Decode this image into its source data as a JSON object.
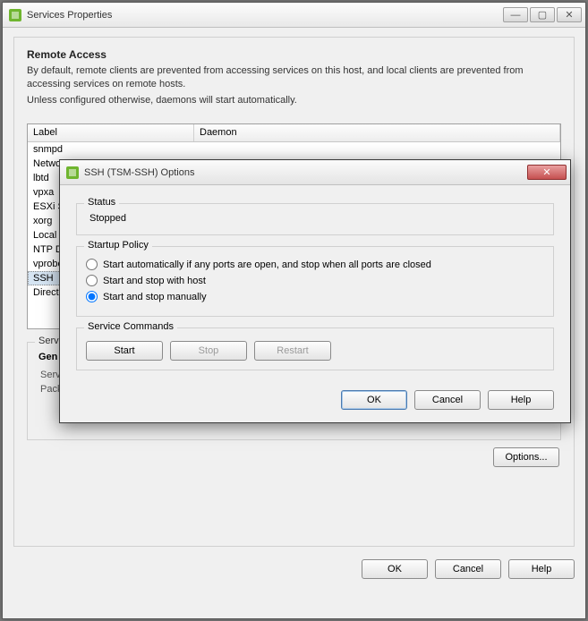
{
  "main": {
    "title": "Services Properties",
    "section_title": "Remote Access",
    "desc1": "By default, remote clients are prevented from accessing services on this host, and local clients are prevented from accessing services on remote hosts.",
    "desc2": "Unless configured otherwise, daemons will start automatically.",
    "columns": {
      "label": "Label",
      "daemon": "Daemon"
    },
    "rows": [
      {
        "label": "snmpd"
      },
      {
        "label": "Network"
      },
      {
        "label": "lbtd"
      },
      {
        "label": "vpxa"
      },
      {
        "label": "ESXi Sh"
      },
      {
        "label": "xorg"
      },
      {
        "label": "Local S"
      },
      {
        "label": "NTP Da"
      },
      {
        "label": "vprobe"
      },
      {
        "label": "SSH"
      },
      {
        "label": "Direct C"
      }
    ],
    "selected_index": 9,
    "details": {
      "group_label": "Service",
      "general_label": "Gen",
      "row1": "Servi",
      "row2": "Packa"
    },
    "options_button": "Options...",
    "ok": "OK",
    "cancel": "Cancel",
    "help": "Help",
    "winbtns": {
      "min": "—",
      "max": "▢",
      "close": "✕"
    }
  },
  "modal": {
    "title": "SSH (TSM-SSH) Options",
    "close_glyph": "✕",
    "status": {
      "legend": "Status",
      "value": "Stopped"
    },
    "policy": {
      "legend": "Startup Policy",
      "opt1": "Start automatically if any ports are open, and stop when all ports are closed",
      "opt2": "Start and stop with host",
      "opt3": "Start and stop manually",
      "selected": 3
    },
    "commands": {
      "legend": "Service Commands",
      "start": "Start",
      "stop": "Stop",
      "restart": "Restart"
    },
    "ok": "OK",
    "cancel": "Cancel",
    "help": "Help"
  },
  "icon_colors": {
    "green": "#6fb52f",
    "orange": "#f0a020"
  }
}
